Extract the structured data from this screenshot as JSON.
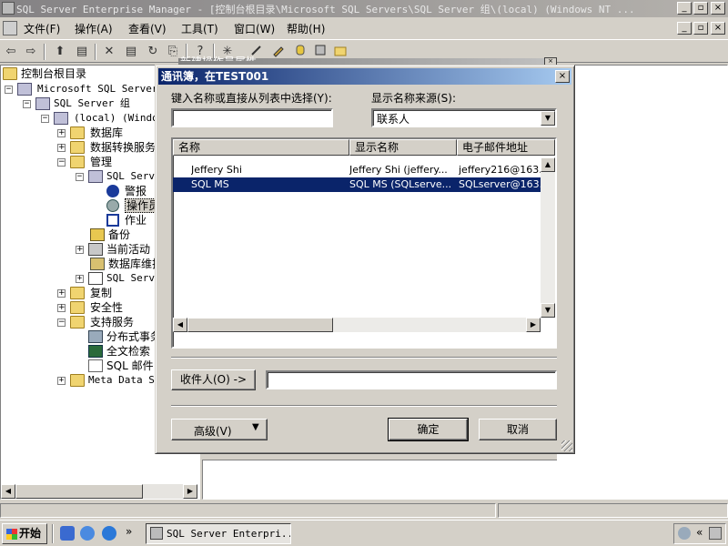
{
  "window": {
    "title": "SQL Server Enterprise Manager - [控制台根目录\\Microsoft SQL Servers\\SQL Server 组\\(local) (Windows NT ...",
    "min_glyph": "_",
    "max_glyph": "▫",
    "close_glyph": "×",
    "inner_min_glyph": "_",
    "inner_max_glyph": "▫",
    "inner_close_glyph": "×"
  },
  "menu": {
    "items": [
      "文件(F)",
      "操作(A)",
      "查看(V)",
      "工具(T)",
      "窗口(W)",
      "帮助(H)"
    ]
  },
  "toolbar": {
    "back_glyph": "⇦",
    "forward_glyph": "⇨",
    "up_glyph": "⬆",
    "delete_glyph": "✕",
    "properties_glyph": "▤",
    "refresh_glyph": "↻",
    "export_glyph": "⎘",
    "help_glyph": "?",
    "star_glyph": "✳"
  },
  "tree": {
    "root": "控制台根目录",
    "items": [
      {
        "label": "Microsoft SQL Servers"
      },
      {
        "label": "SQL Server 组"
      },
      {
        "label": "(local) (Window"
      },
      {
        "label": "数据库"
      },
      {
        "label": "数据转换服务"
      },
      {
        "label": "管理"
      },
      {
        "label": "SQL Serve"
      },
      {
        "label": "警报"
      },
      {
        "label": "操作员"
      },
      {
        "label": "作业"
      },
      {
        "label": "备份"
      },
      {
        "label": "当前活动"
      },
      {
        "label": "数据库维护"
      },
      {
        "label": "SQL Serve"
      },
      {
        "label": "复制"
      },
      {
        "label": "安全性"
      },
      {
        "label": "支持服务"
      },
      {
        "label": "分布式事务"
      },
      {
        "label": "全文检索"
      },
      {
        "label": "SQL 邮件"
      },
      {
        "label": "Meta Data Se"
      }
    ]
  },
  "background_tab": {
    "label": "新建操作员属性"
  },
  "dialog": {
    "title": "通讯簿，在TEST001",
    "close_glyph": "×",
    "name_label": "键入名称或直接从列表中选择(Y):",
    "name_value": "",
    "source_label": "显示名称来源(S):",
    "source_value": "联系人",
    "columns": [
      "名称",
      "显示名称",
      "电子邮件地址"
    ],
    "rows": [
      {
        "name": "Jeffery Shi",
        "display": "Jeffery Shi (jeffery...",
        "email": "jeffery216@163."
      },
      {
        "name": "SQL MS",
        "display": "SQL MS (SQLserve...",
        "email": "SQLserver@163."
      }
    ],
    "selected_row": 1,
    "recipients_button": "收件人(O) ->",
    "recipients_value": "",
    "advanced_button": "高级(V)",
    "ok_button": "确定",
    "cancel_button": "取消"
  },
  "taskbar": {
    "start_label": "开始",
    "more_glyph": "»",
    "task_label": "SQL Server Enterpri...",
    "tray_chevron": "«"
  }
}
